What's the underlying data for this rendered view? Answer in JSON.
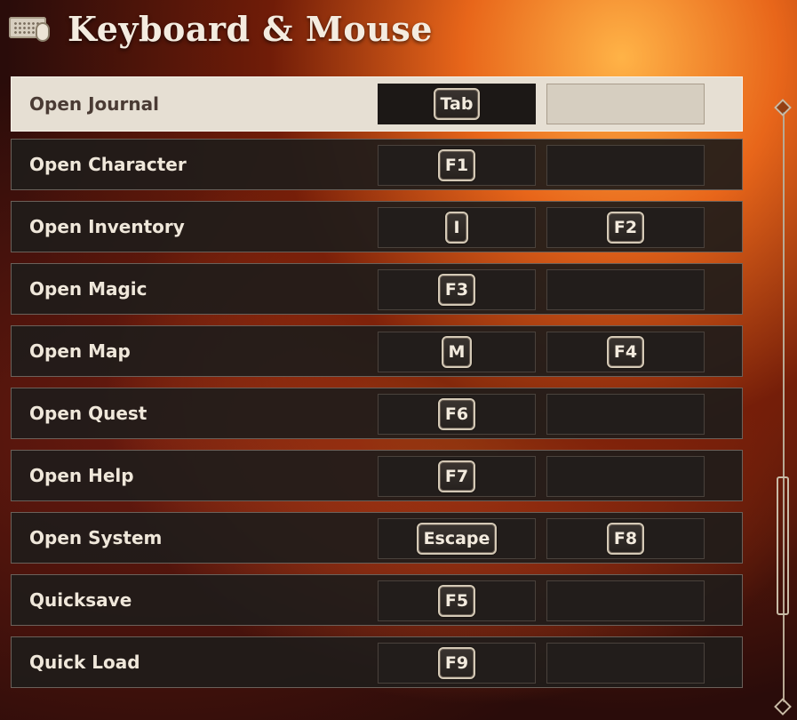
{
  "header": {
    "title": "Keyboard & Mouse",
    "icon": "keyboard-mouse-icon"
  },
  "bindings": [
    {
      "action": "Open Journal",
      "primary": "Tab",
      "secondary": ""
    },
    {
      "action": "Open Character",
      "primary": "F1",
      "secondary": ""
    },
    {
      "action": "Open Inventory",
      "primary": "I",
      "secondary": "F2"
    },
    {
      "action": "Open Magic",
      "primary": "F3",
      "secondary": ""
    },
    {
      "action": "Open Map",
      "primary": "M",
      "secondary": "F4"
    },
    {
      "action": "Open Quest",
      "primary": "F6",
      "secondary": ""
    },
    {
      "action": "Open Help",
      "primary": "F7",
      "secondary": ""
    },
    {
      "action": "Open System",
      "primary": "Escape",
      "secondary": "F8"
    },
    {
      "action": "Quicksave",
      "primary": "F5",
      "secondary": ""
    },
    {
      "action": "Quick Load",
      "primary": "F9",
      "secondary": ""
    }
  ],
  "colors": {
    "accent": "#e6dfd3",
    "row_bg": "#201c1a",
    "text": "#efe7da"
  }
}
